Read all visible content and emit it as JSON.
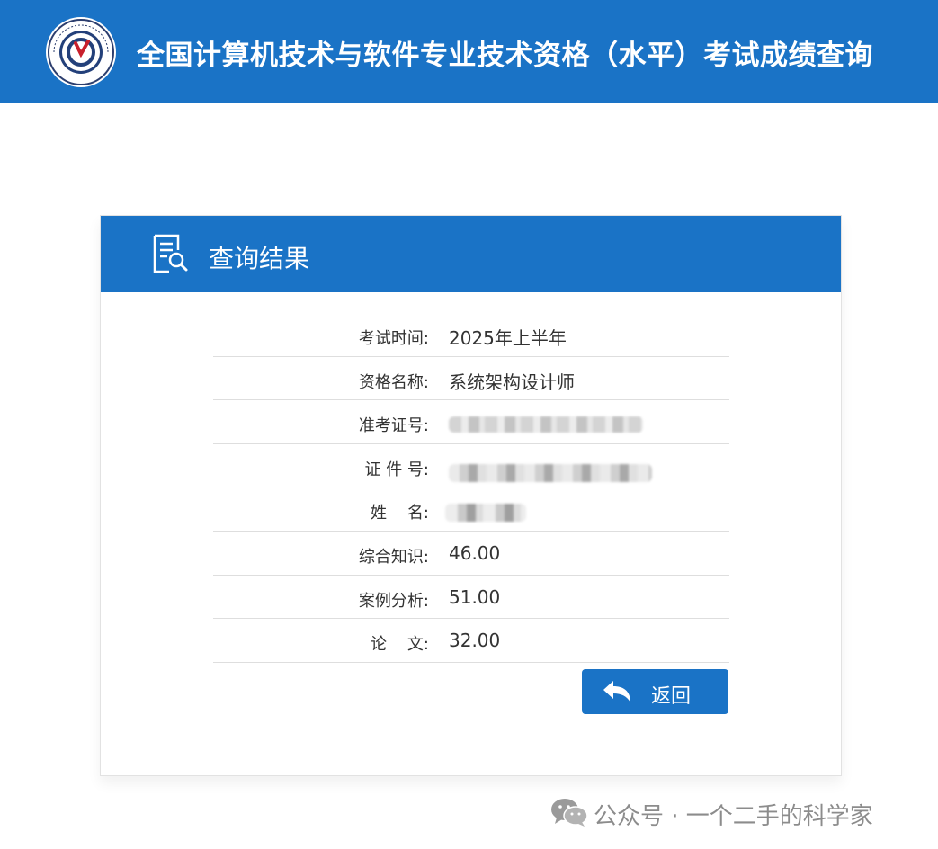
{
  "header": {
    "site_title": "全国计算机技术与软件专业技术资格（水平）考试成绩查询",
    "logo_icon": "exam-seal-logo",
    "background_color": "#1a73c6"
  },
  "card": {
    "title": "查询结果",
    "title_icon": "document-search-icon",
    "rows": [
      {
        "label": "考试时间:",
        "value": "2025年上半年"
      },
      {
        "label": "资格名称:",
        "value": "系统架构设计师"
      },
      {
        "label": "准考证号:",
        "value": ""
      },
      {
        "label": "证 件 号:",
        "value": ""
      },
      {
        "label": "姓    名:",
        "value": ""
      },
      {
        "label": "综合知识:",
        "value": "46.00"
      },
      {
        "label": "案例分析:",
        "value": "51.00"
      },
      {
        "label": "论    文:",
        "value": "32.00"
      }
    ],
    "back_button": {
      "label": "返回",
      "icon": "reply-arrow-icon"
    }
  },
  "watermark": {
    "icon": "wechat-icon",
    "text": "公众号 · 一个二手的科学家"
  }
}
